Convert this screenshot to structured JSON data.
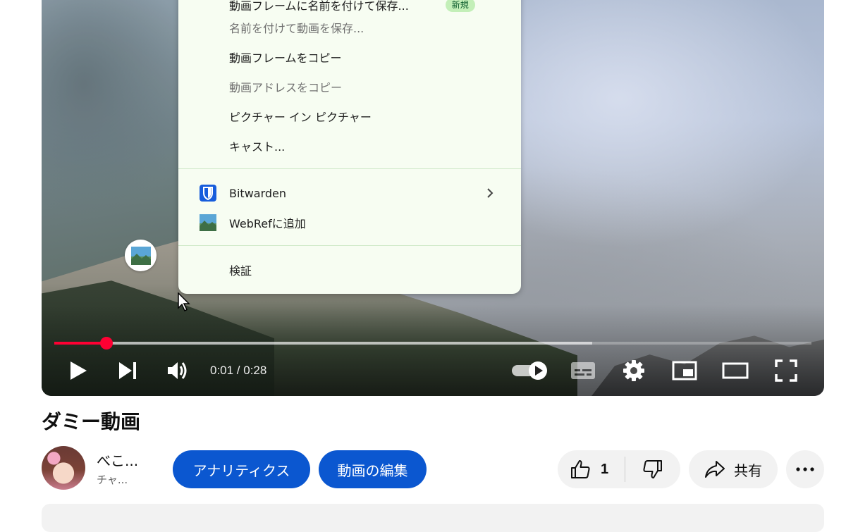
{
  "context_menu": {
    "items": [
      {
        "label": "動画フレームに名前を付けて保存...",
        "badge": "新規",
        "disabled": false
      },
      {
        "label": "名前を付けて動画を保存...",
        "disabled": true
      },
      {
        "label": "動画フレームをコピー",
        "disabled": false
      },
      {
        "label": "動画アドレスをコピー",
        "disabled": true
      },
      {
        "label": "ピクチャー イン ピクチャー",
        "disabled": false
      },
      {
        "label": "キャスト...",
        "disabled": false
      }
    ],
    "extensions": [
      {
        "label": "Bitwarden",
        "icon": "bitwarden-shield-icon",
        "has_submenu": true
      },
      {
        "label": "WebRefに追加",
        "icon": "webref-icon",
        "has_submenu": false
      }
    ],
    "inspect_label": "検証"
  },
  "player": {
    "time_display": "0:01 / 0:28",
    "progress_fraction": 0.069,
    "buffered_fraction": 0.71,
    "autoplay_on": true,
    "controls": [
      "play-icon",
      "next-icon",
      "volume-icon",
      "autoplay-toggle-icon",
      "subtitles-icon",
      "settings-gear-icon",
      "miniplayer-icon",
      "theater-mode-icon",
      "fullscreen-icon"
    ],
    "accent_color": "#ff0033"
  },
  "video": {
    "title": "ダミー動画",
    "channel_name": "べこ...",
    "channel_subtitle": "チャ..."
  },
  "actions": {
    "analytics_label": "アナリティクス",
    "edit_label": "動画の編集",
    "like_count": "1",
    "share_label": "共有",
    "button_color": "#0b57d0"
  }
}
